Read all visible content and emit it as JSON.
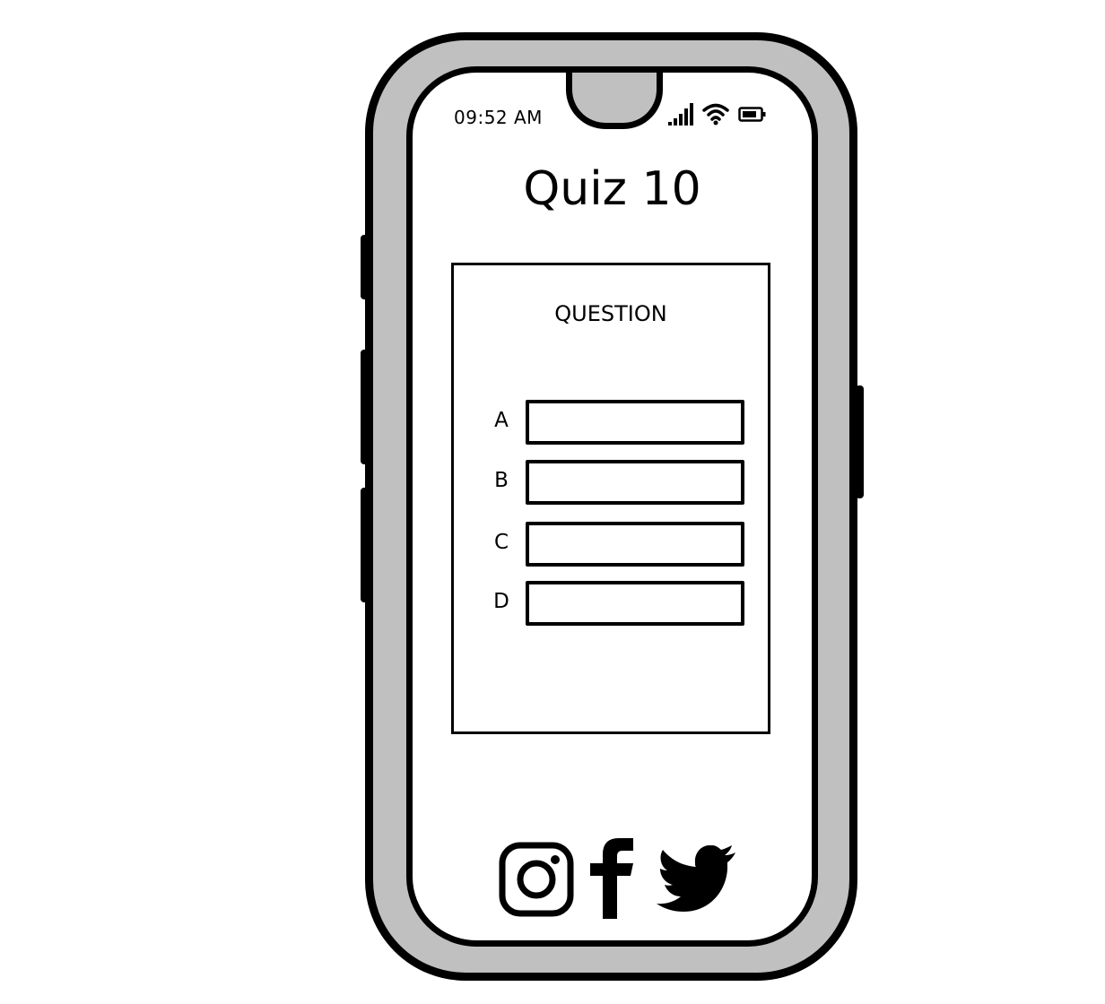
{
  "status_bar": {
    "time": "09:52 AM",
    "icons": [
      "cellular-signal-icon",
      "wifi-icon",
      "battery-icon"
    ]
  },
  "page": {
    "title": "Quiz 10"
  },
  "quiz": {
    "question_label": "QUESTION",
    "answers": [
      {
        "letter": "A",
        "value": ""
      },
      {
        "letter": "B",
        "value": ""
      },
      {
        "letter": "C",
        "value": ""
      },
      {
        "letter": "D",
        "value": ""
      }
    ]
  },
  "social": {
    "icons": [
      "instagram-icon",
      "facebook-icon",
      "twitter-icon"
    ]
  },
  "colors": {
    "frame": "#c0c0c0",
    "outline": "#000000",
    "screen": "#ffffff"
  }
}
